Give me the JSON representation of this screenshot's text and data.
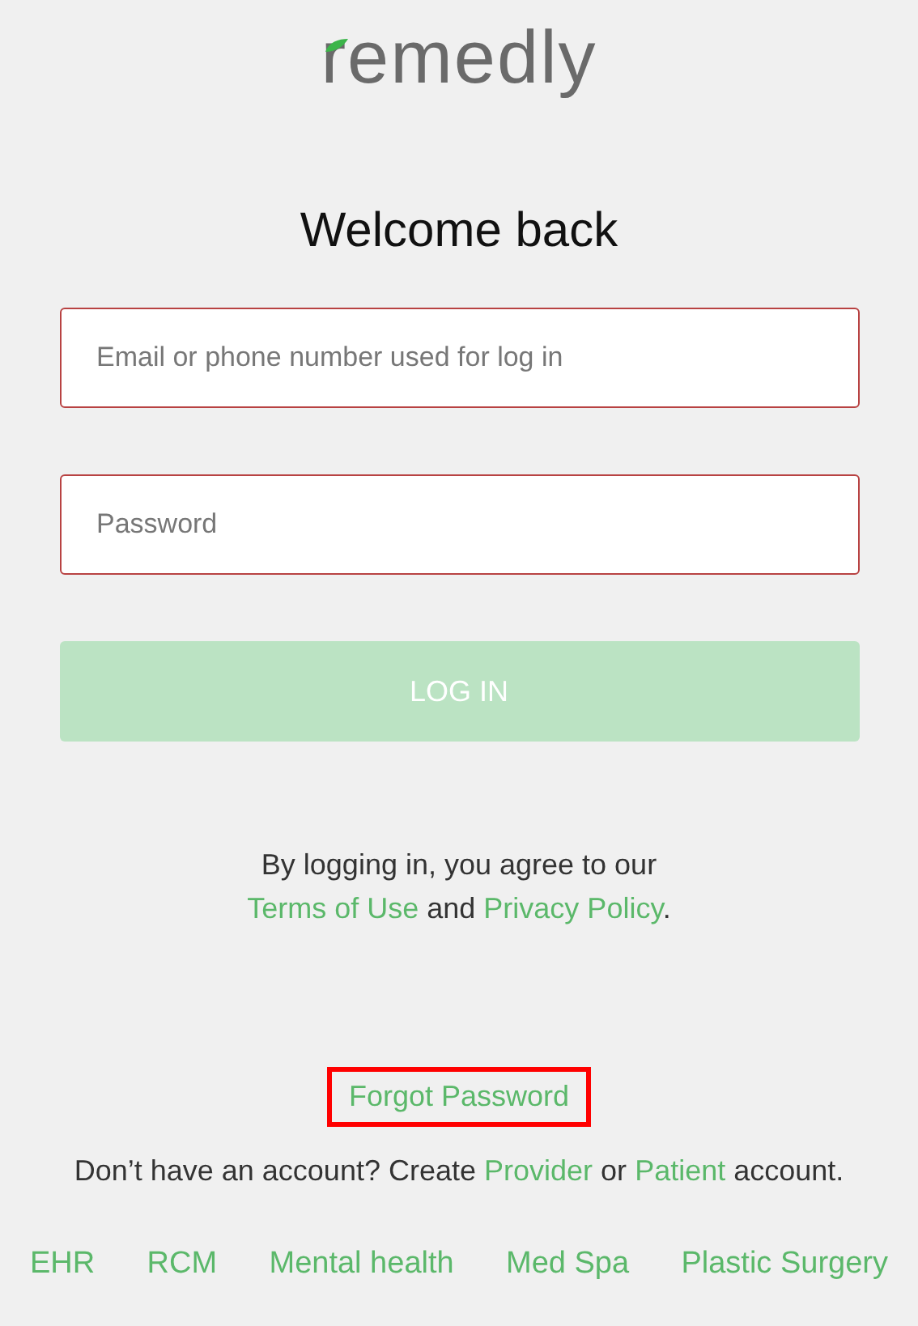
{
  "logo": {
    "text": "remedly"
  },
  "title": "Welcome back",
  "fields": [
    {
      "placeholder": "Email or phone number used for log in"
    },
    {
      "placeholder": "Password"
    }
  ],
  "login_button": {
    "label": "LOG IN",
    "disabled": true
  },
  "agreement": {
    "intro": "By logging in, you agree to our",
    "terms": "Terms of Use",
    "joiner": "and",
    "privacy": "Privacy Policy",
    "end": "."
  },
  "forgot_password": {
    "label": "Forgot Password",
    "highlighted": true
  },
  "signup": {
    "intro": "Don’t have an account? Create",
    "provider": "Provider",
    "joiner": "or",
    "patient": "Patient",
    "end": "account."
  },
  "footer_links": [
    "EHR",
    "RCM",
    "Mental health",
    "Med Spa",
    "Plastic Surgery"
  ]
}
